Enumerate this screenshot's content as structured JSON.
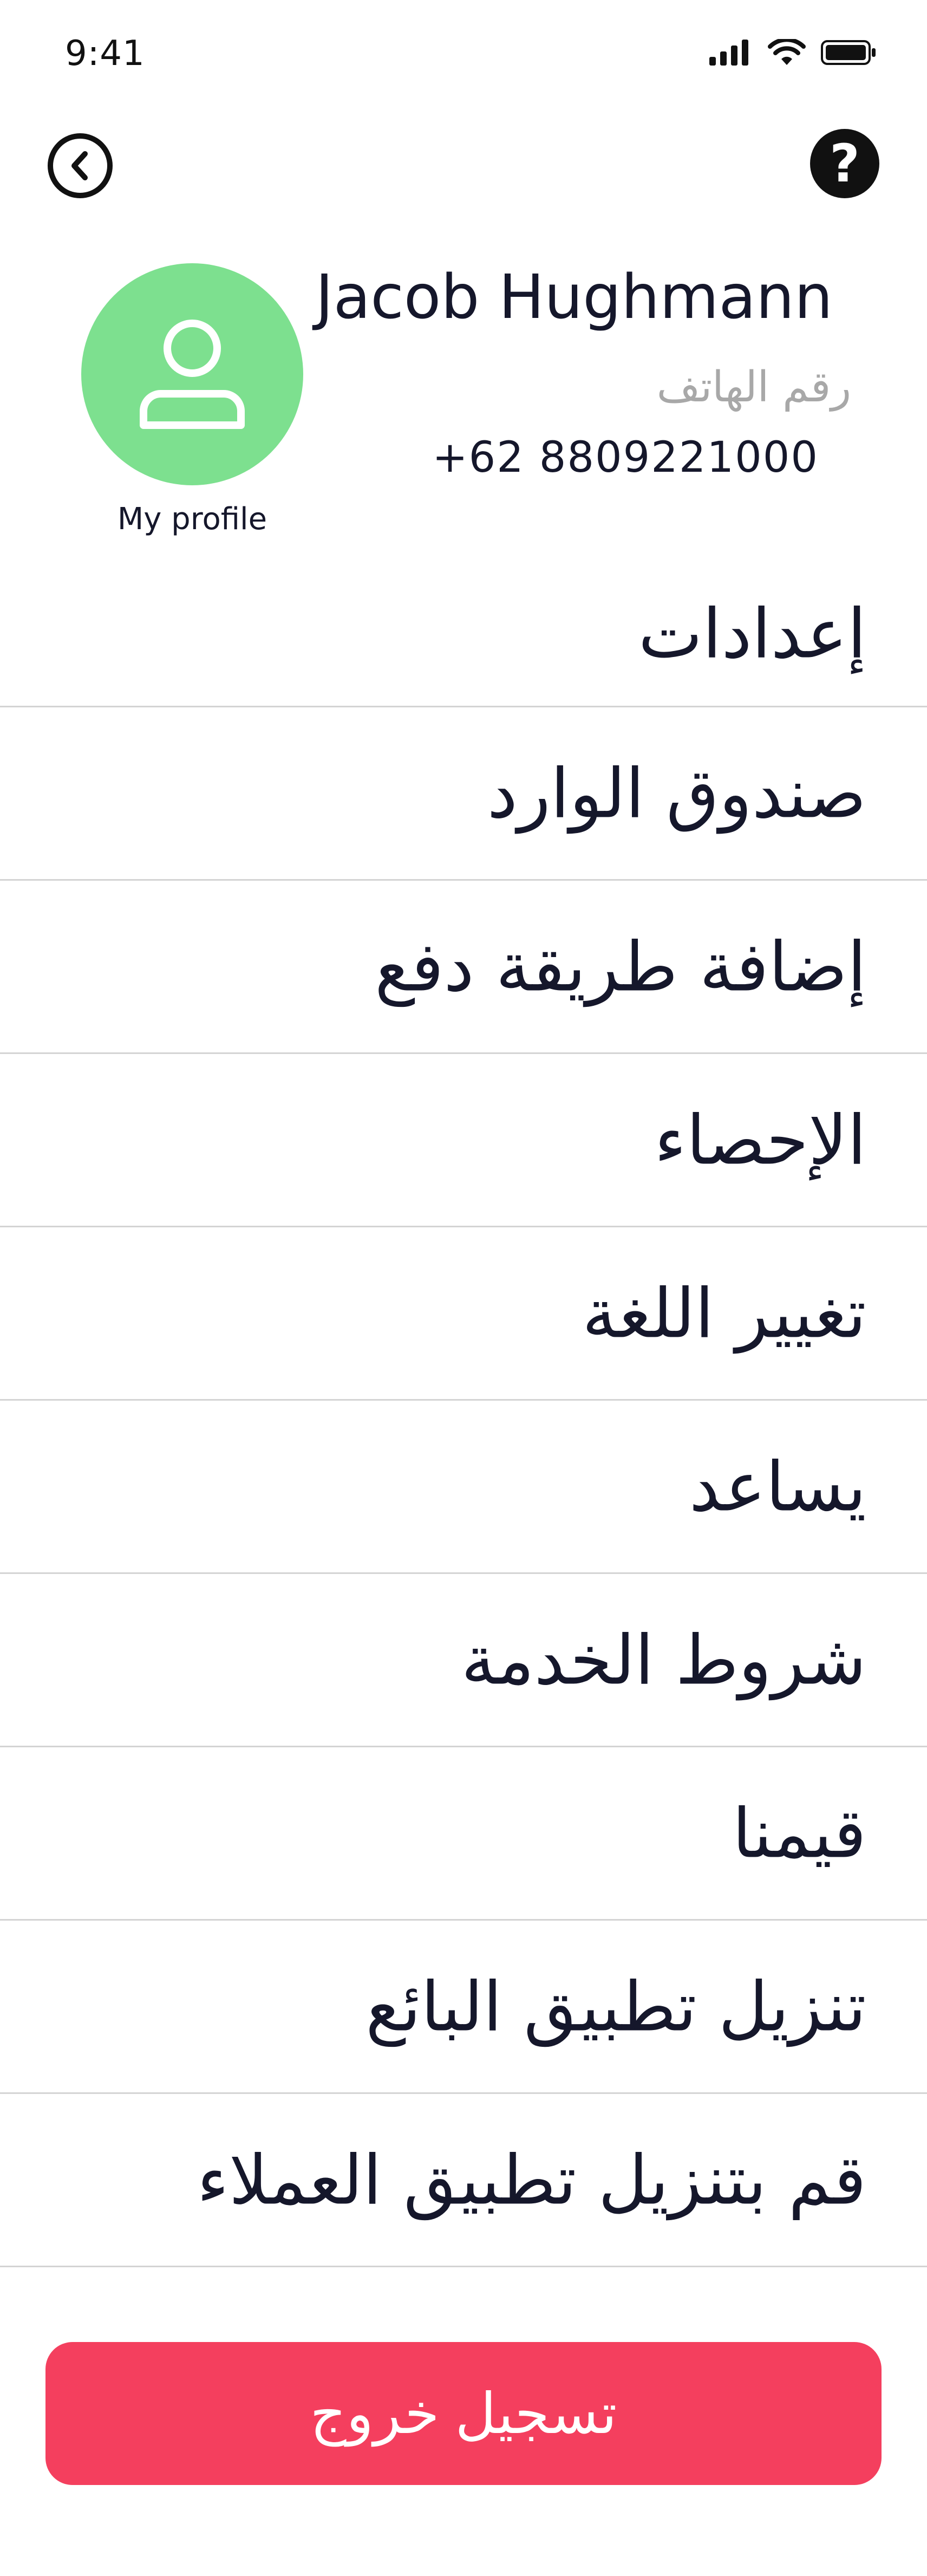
{
  "status_bar": {
    "time": "9:41"
  },
  "header": {
    "back_icon": "chevron-left-circle-icon",
    "help_icon": "question-mark-circle-icon",
    "help_glyph": "?"
  },
  "profile": {
    "avatar_icon": "user-icon",
    "avatar_color": "#7de08f",
    "label": "My profile",
    "name": "Jacob Hughmann",
    "phone_label": "رقم الهاتف",
    "phone_number": "+62 8809221000"
  },
  "menu": {
    "items": [
      {
        "label": "إعدادات"
      },
      {
        "label": "صندوق الوارد"
      },
      {
        "label": "إضافة طريقة دفع"
      },
      {
        "label": "الإحصاء"
      },
      {
        "label": "تغيير اللغة"
      },
      {
        "label": "يساعد"
      },
      {
        "label": "شروط الخدمة"
      },
      {
        "label": "قيمنا"
      },
      {
        "label": "تنزيل تطبيق البائع"
      },
      {
        "label": "قم بتنزيل تطبيق العملاء"
      }
    ]
  },
  "logout": {
    "label": "تسجيل خروج",
    "color": "#f43f5e"
  }
}
